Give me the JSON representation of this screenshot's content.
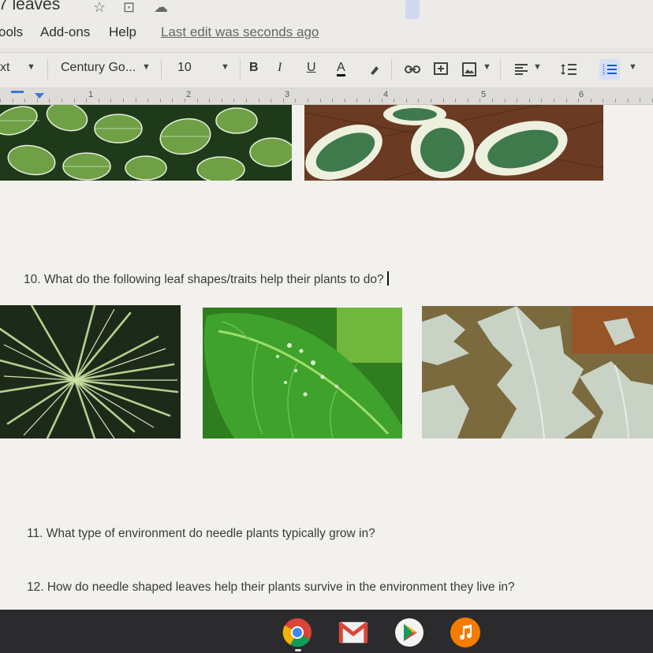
{
  "document": {
    "title": "7 leaves",
    "star_icon": "☆",
    "move_icon": "⊡",
    "cloud_icon": "☁"
  },
  "menu": {
    "items": [
      "ools",
      "Add-ons",
      "Help"
    ],
    "last_edit": "Last edit was seconds ago"
  },
  "toolbar": {
    "style_partial": "xt",
    "font": "Century Go...",
    "size": "10",
    "bold": "B",
    "italic": "I",
    "underline": "U",
    "text_color": "A"
  },
  "ruler": {
    "numbers": [
      "1",
      "2",
      "3",
      "4",
      "5",
      "6"
    ]
  },
  "questions": {
    "q10": "10. What do the following leaf shapes/traits help their plants to do?",
    "q11": "11. What type of environment do needle plants typically grow in?",
    "q12": "12. How do needle shaped leaves help their plants survive in the environment they live in?"
  },
  "images": {
    "top": [
      "nerve-plant-leaves",
      "hosta-leaves"
    ],
    "row": [
      "palm-leaf",
      "wet-green-leaf",
      "dusty-miller-leaves"
    ]
  },
  "shelf": {
    "apps": [
      "chrome-icon",
      "gmail-icon",
      "play-store-icon",
      "music-icon"
    ]
  },
  "colors": {
    "chrome_red": "#db4437",
    "chrome_yellow": "#f4b400",
    "chrome_green": "#0f9d58",
    "chrome_blue": "#4285f4",
    "music_orange": "#f57c00"
  }
}
